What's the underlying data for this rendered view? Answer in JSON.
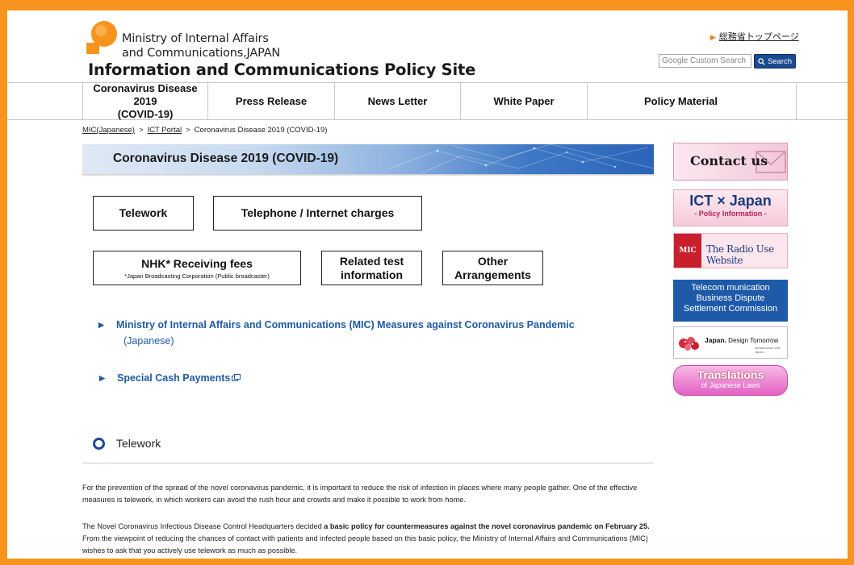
{
  "header": {
    "logo_line1": "Ministry of Internal Affairs",
    "logo_line2": "and Communications,JAPAN",
    "site_title": "Information and Communications Policy Site",
    "top_link": "総務省トップページ",
    "search_placeholder": "Google Custom Search",
    "search_button": "Search"
  },
  "nav": {
    "items": [
      {
        "label_line1": "Coronavirus Disease 2019",
        "label_line2": "(COVID-19)"
      },
      {
        "label": "Press Release"
      },
      {
        "label": "News Letter"
      },
      {
        "label": "White Paper"
      },
      {
        "label": "Policy Material"
      }
    ]
  },
  "breadcrumb": {
    "items": [
      "MIC(Japanese)",
      "ICT Portal",
      "Coronavirus Disease 2019 (COVID-19)"
    ],
    "separator": ">"
  },
  "banner": {
    "title": "Coronavirus Disease 2019 (COVID-19)"
  },
  "topics": {
    "telework": "Telework",
    "telephone": "Telephone / Internet charges",
    "nhk": "NHK* Receiving fees",
    "nhk_note": "*Japan Broadcasting Corporation (Public broadcaster)",
    "related_line1": "Related test",
    "related_line2": "information",
    "other_line1": "Other",
    "other_line2": "Arrangements"
  },
  "links": {
    "mic_measures": "Ministry of Internal Affairs and Communications (MIC) Measures against Coronavirus Pandemic",
    "mic_measures_sub": "(Japanese)",
    "cash_payments": "Special Cash Payments"
  },
  "section": {
    "title": "Telework",
    "para1": "For the prevention of the spread of the novel coronavirus pandemic, it is important to reduce the risk of infection in places where many people gather. One of the effective measures is telework, in which workers can avoid the rush hour and crowds and make it possible to work from home.",
    "para2_a": "The Novel Coronavirus Infectious Disease Control Headquarters decided ",
    "para2_b": "a basic policy for countermeasures against the novel coronavirus pandemic on February 25.",
    "para2_c": " From the viewpoint of reducing the chances of contact with patients and infected people based on this basic policy, the Ministry of Internal Affairs and Communications (MIC) wishes to ask that you actively use telework as much as possible."
  },
  "sidebar": {
    "contact": "Contact us",
    "ict_big": "ICT × Japan",
    "ict_small": "- Policy Information -",
    "radio_badge": "MIC",
    "radio_text": "The Radio Use Website",
    "telecom_line1": "Telecom munication",
    "telecom_line2": "Business Dispute",
    "telecom_line3": "Settlement Commission",
    "japan_brand": "Japan.",
    "japan_tag": "Design Tomorrow",
    "japan_tiny": "Infrastructure with Japan",
    "trans_big": "Translations",
    "trans_small": "of Japanese Laws"
  },
  "colors": {
    "frame": "#F7941D",
    "link": "#1f5aa5",
    "accent_blue": "#1b4a8f"
  }
}
